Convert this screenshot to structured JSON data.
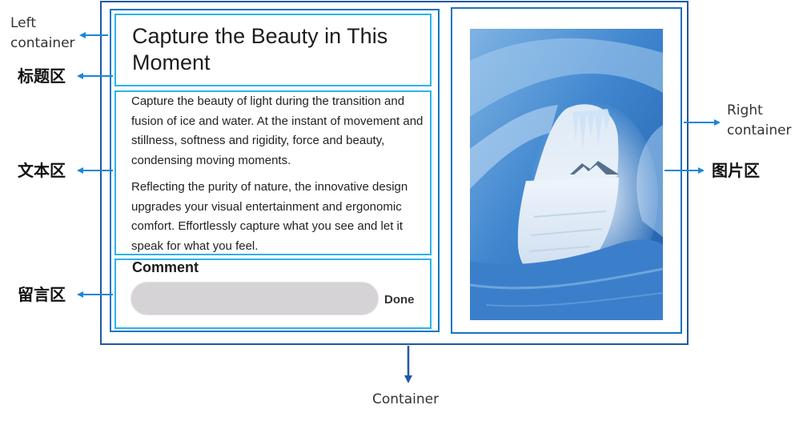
{
  "main": {
    "title": "Capture the Beauty in This Moment",
    "paragraphs": [
      "Capture the beauty of light during the transition and fusion of ice and water. At the instant of movement and stillness, softness and rigidity, force and beauty, condensing moving moments.",
      "Reflecting the purity of nature, the innovative design upgrades your visual entertainment and ergonomic comfort. Effortlessly capture what you see and let it speak for what you feel."
    ],
    "comment_label": "Comment",
    "comment_input_value": "",
    "done_label": "Done"
  },
  "annotations": {
    "left_container": "Left\ncontainer",
    "title_area": "标题区",
    "text_area": "文本区",
    "comment_area": "留言区",
    "right_container": "Right\ncontainer",
    "picture_area": "图片区",
    "container": "Container"
  },
  "colors": {
    "outer_border": "#1f57a7",
    "container_border": "#1a73c4",
    "region_border": "#2bb3ec",
    "arrow": "#1b86d6",
    "input_fill": "#d6d3d6"
  }
}
